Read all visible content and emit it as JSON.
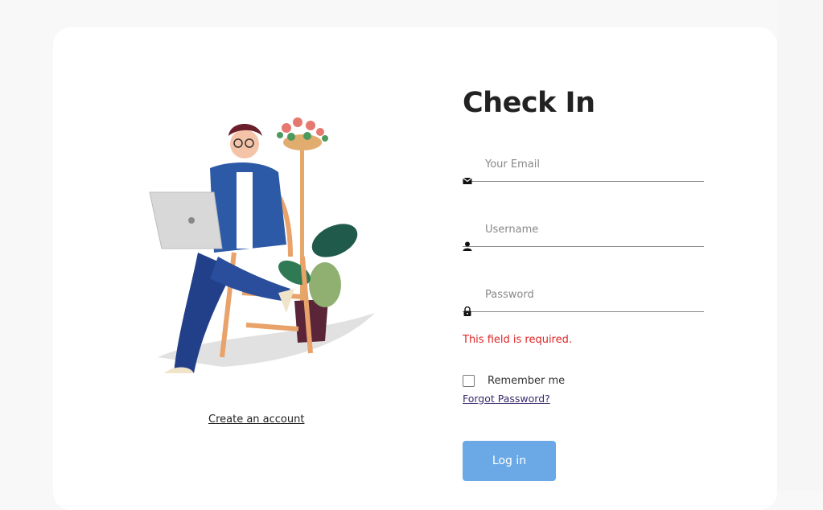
{
  "form": {
    "title": "Check In",
    "email": {
      "placeholder": "Your Email",
      "value": "",
      "icon": "envelope-icon"
    },
    "username": {
      "placeholder": "Username",
      "value": "",
      "icon": "person-icon"
    },
    "password": {
      "placeholder": "Password",
      "value": "",
      "icon": "lock-icon"
    },
    "error": "This field is required.",
    "remember_label": "Remember me",
    "remember_checked": false,
    "forgot_label": "Forgot Password?",
    "login_label": "Log in"
  },
  "left": {
    "create_account_label": "Create an account",
    "illustration": "person-with-laptop-illustration"
  },
  "colors": {
    "background": "#f8f8f8",
    "card": "#ffffff",
    "accent": "#6aa9e6",
    "error": "#e02424",
    "link": "#3a2a6b"
  }
}
